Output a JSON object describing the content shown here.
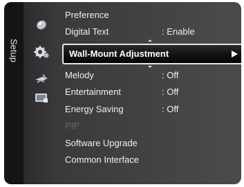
{
  "side_title": "Setup",
  "icons": [
    "picture-icon",
    "setup-gear-icon",
    "input-icon",
    "application-icon"
  ],
  "menu": {
    "above": [
      {
        "label": "Preference",
        "value": ""
      },
      {
        "label": "Digital Text",
        "value": ": Enable"
      }
    ],
    "selected": {
      "label": "Wall-Mount Adjustment"
    },
    "below": [
      {
        "label": "Melody",
        "value": ": Off"
      },
      {
        "label": "Entertainment",
        "value": ": Off"
      },
      {
        "label": "Energy Saving",
        "value": ": Off"
      },
      {
        "label": "PIP",
        "value": "",
        "disabled": true
      },
      {
        "label": "Software Upgrade",
        "value": ""
      },
      {
        "label": "Common Interface",
        "value": ""
      }
    ]
  }
}
